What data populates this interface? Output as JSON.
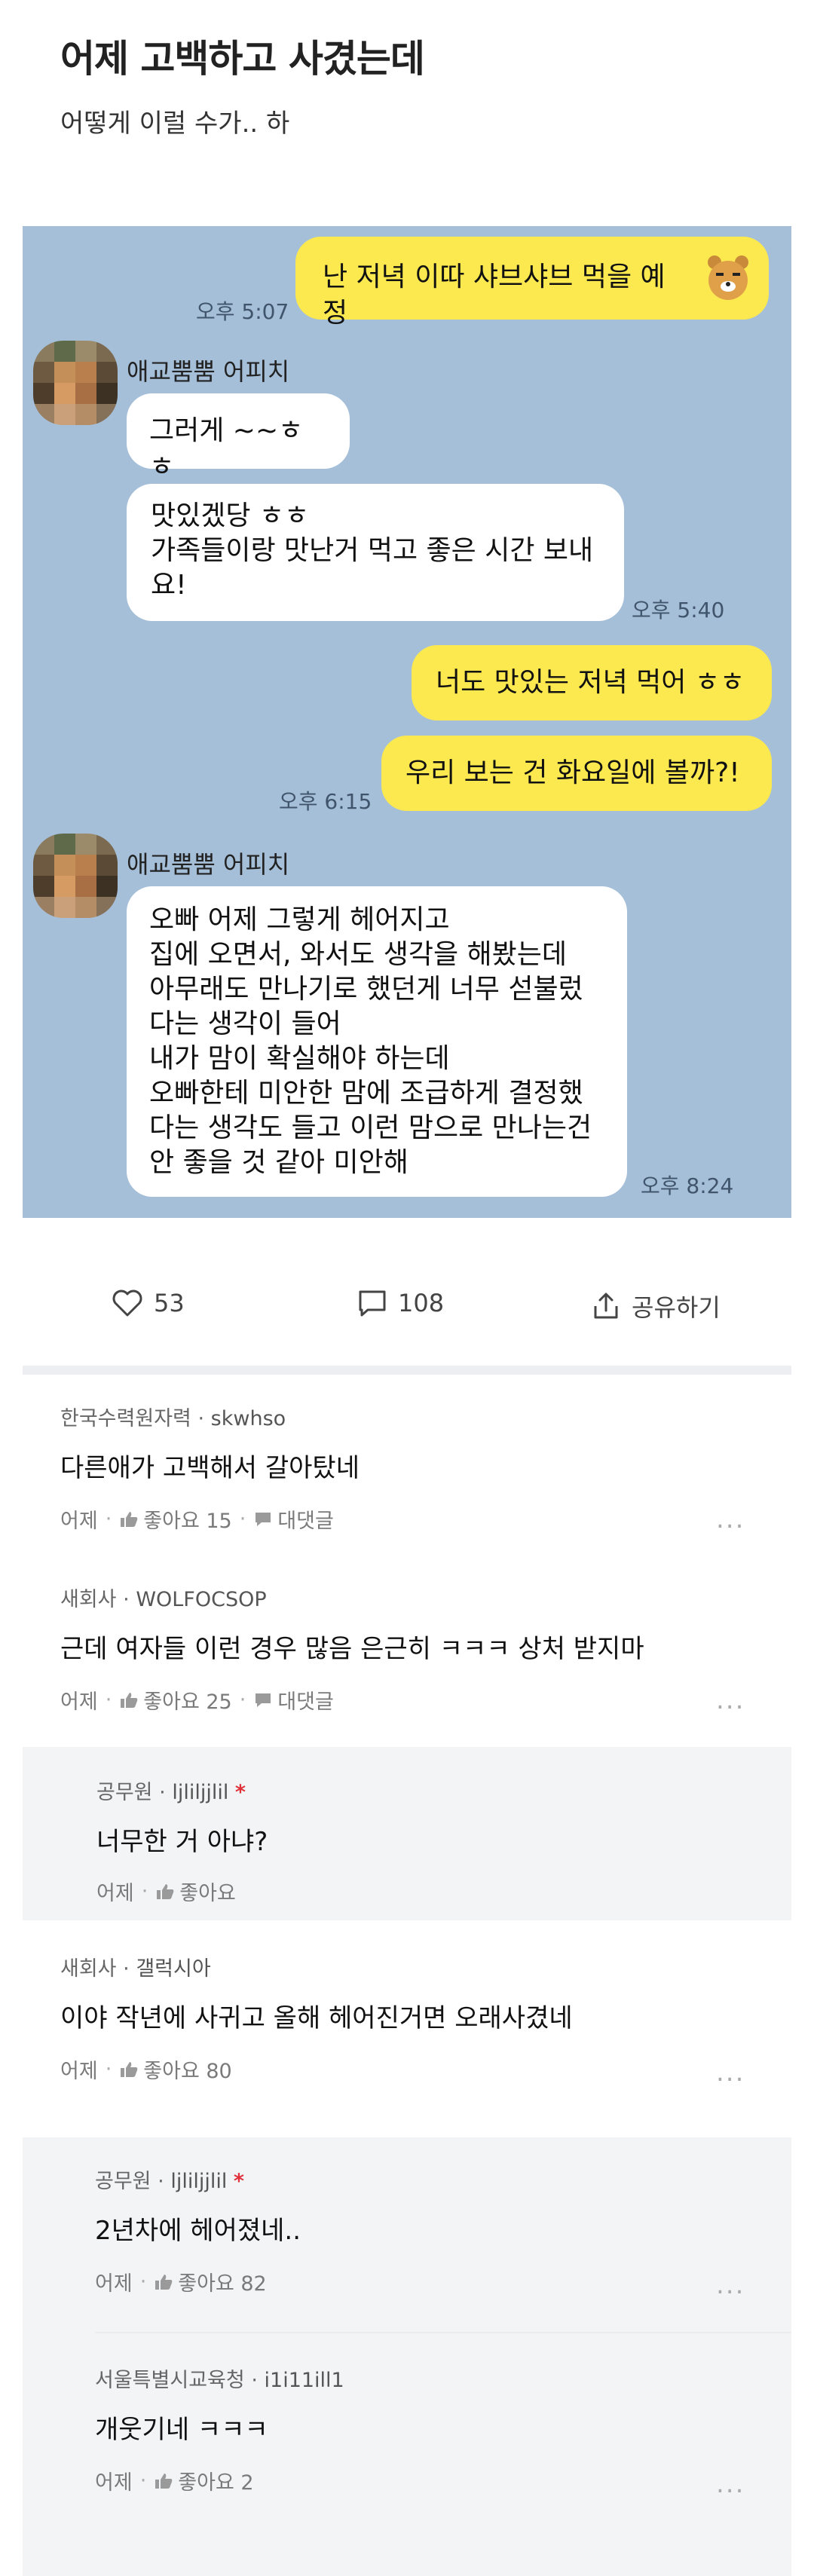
{
  "post": {
    "title": "어제 고백하고 사겼는데",
    "subtitle": "어떻게 이럴 수가.. 하"
  },
  "chat": {
    "messages": [
      {
        "text": "난 저녁 이따 샤브샤브 먹을 예정",
        "time": "오후 5:07"
      },
      {
        "sender": "애교뿜뿜 어피치",
        "text": "그러게 ~~ㅎㅎ"
      },
      {
        "text1": "맛있겠당 ㅎㅎ",
        "text2": "가족들이랑 맛난거 먹고 좋은 시간 보내",
        "text3": "요!",
        "time": "오후 5:40"
      },
      {
        "text": "너도 맛있는 저녁 먹어 ㅎㅎ"
      },
      {
        "text": "우리 보는 건 화요일에 볼까?!",
        "time": "오후 6:15"
      },
      {
        "sender": "애교뿜뿜 어피치",
        "lines": [
          "오빠 어제 그렇게 헤어지고",
          "집에 오면서, 와서도 생각을 해봤는데",
          "아무래도 만나기로 했던게 너무 섣불렀",
          "다는 생각이 들어",
          "내가 맘이 확실해야 하는데",
          "오빠한테 미안한 맘에 조급하게 결정했",
          "다는 생각도 들고 이런 맘으로 만나는건",
          "안 좋을 것 같아 미안해"
        ],
        "time": "오후 8:24"
      }
    ]
  },
  "actions": {
    "likes": "53",
    "comments": "108",
    "share": "공유하기"
  },
  "comments": [
    {
      "company": "한국수력원자력",
      "nick": "skwhso",
      "text": "다른애가 고백해서 갈아탔네",
      "date": "어제",
      "like": "좋아요 15",
      "reply": "대댓글"
    },
    {
      "company": "새회사",
      "nick": "WOLFOCSOP",
      "text": "근데 여자들 이런 경우 많음 은근히 ㅋㅋㅋ 상처 받지마",
      "date": "어제",
      "like": "좋아요 25",
      "reply": "대댓글"
    },
    {
      "company": "공무원",
      "nick": "ljliljjlil",
      "star": "*",
      "text": "너무한 거 아냐?",
      "date": "어제",
      "like": "좋아요"
    },
    {
      "company": "새회사",
      "nick": "갤럭시아",
      "text": "이야 작년에 사귀고 올해 헤어진거면 오래사겼네",
      "date": "어제",
      "like": "좋아요 80"
    },
    {
      "company": "공무원",
      "nick": "ljliljjlil",
      "star": "*",
      "text": "2년차에 헤어졌네..",
      "date": "어제",
      "like": "좋아요 82"
    },
    {
      "company": "서울특별시교육청",
      "nick": "i1i11ill1",
      "text": "개웃기네 ㅋㅋㅋ",
      "date": "어제",
      "like": "좋아요 2"
    }
  ],
  "more_label": "...",
  "separator": "·"
}
